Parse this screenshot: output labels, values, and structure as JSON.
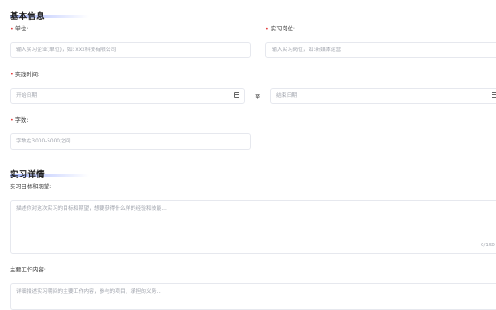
{
  "basic": {
    "title": "基本信息",
    "unit_label": "单位:",
    "unit_placeholder": "输入实习企业(单位)，如: xxx科技有限公司",
    "position_label": "实习岗位:",
    "position_placeholder": "输入实习岗位，如:新媒体运营",
    "time_label": "实践时间:",
    "start_placeholder": "开始日期",
    "to_label": "至",
    "end_placeholder": "结束日期",
    "words_label": "字数:",
    "words_placeholder": "字数在3000-5000之间"
  },
  "details": {
    "title": "实习详情",
    "goal_label": "实习目标和期望:",
    "goal_placeholder": "描述你对这次实习的目标和期望，想要获得什么样的经验和技能...",
    "goal_counter": "0/150",
    "work_label": "主要工作内容:",
    "work_placeholder": "详细描述实习期间的主要工作内容，参与的项目、承担的义务..."
  }
}
